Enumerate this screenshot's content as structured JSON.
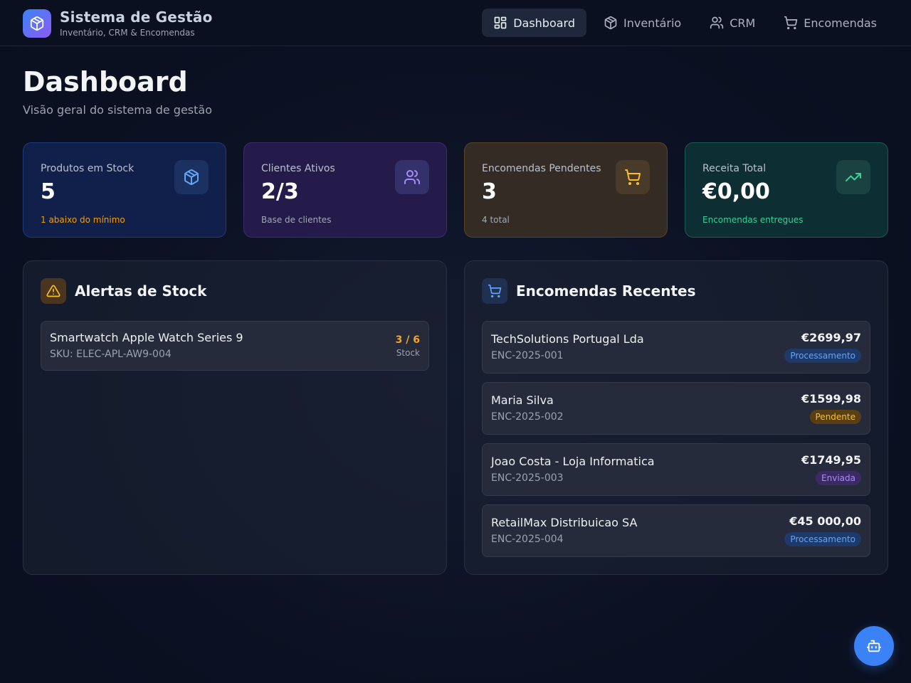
{
  "header": {
    "title": "Sistema de Gestão",
    "subtitle": "Inventário, CRM & Encomendas",
    "logo_icon": "package-icon",
    "nav": [
      {
        "label": "Dashboard",
        "icon": "grid-icon",
        "active": true
      },
      {
        "label": "Inventário",
        "icon": "package-icon",
        "active": false
      },
      {
        "label": "CRM",
        "icon": "users-icon",
        "active": false
      },
      {
        "label": "Encomendas",
        "icon": "cart-icon",
        "active": false
      }
    ]
  },
  "page": {
    "title": "Dashboard",
    "subtitle": "Visão geral do sistema de gestão"
  },
  "stats": [
    {
      "label": "Produtos em Stock",
      "value": "5",
      "note": "1 abaixo do mínimo",
      "icon": "package-icon",
      "accent": "#60a5fa"
    },
    {
      "label": "Clientes Ativos",
      "value": "2/3",
      "note": "Base de clientes",
      "icon": "users-icon",
      "accent": "#a78bfa"
    },
    {
      "label": "Encomendas Pendentes",
      "value": "3",
      "note": "4 total",
      "icon": "cart-icon",
      "accent": "#fbbf24"
    },
    {
      "label": "Receita Total",
      "value": "€0,00",
      "note": "Encomendas entregues",
      "icon": "trending-up-icon",
      "accent": "#34d399"
    }
  ],
  "stock_alerts": {
    "title": "Alertas de Stock",
    "icon": "warning-icon",
    "items": [
      {
        "name": "Smartwatch Apple Watch Series 9",
        "sku": "SKU: ELEC-APL-AW9-004",
        "qty": "3 / 6",
        "unit": "Stock"
      }
    ]
  },
  "recent_orders": {
    "title": "Encomendas Recentes",
    "icon": "cart-icon",
    "items": [
      {
        "customer": "TechSolutions Portugal Lda",
        "code": "ENC-2025-001",
        "amount": "€2699,97",
        "status": "Processamento"
      },
      {
        "customer": "Maria Silva",
        "code": "ENC-2025-002",
        "amount": "€1599,98",
        "status": "Pendente"
      },
      {
        "customer": "Joao Costa - Loja Informatica",
        "code": "ENC-2025-003",
        "amount": "€1749,95",
        "status": "Enviada"
      },
      {
        "customer": "RetailMax Distribuicao SA",
        "code": "ENC-2025-004",
        "amount": "€45 000,00",
        "status": "Processamento"
      }
    ]
  },
  "fab": {
    "icon": "bot-icon"
  }
}
